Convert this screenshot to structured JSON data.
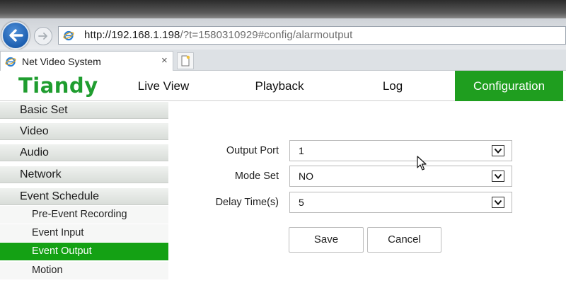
{
  "browser": {
    "url_host": "http://192.168.1.198",
    "url_rest": "/?t=1580310929#config/alarmoutput",
    "tab_title": "Net Video System",
    "tab_close": "×"
  },
  "app": {
    "logo": "Tiandy",
    "nav": [
      {
        "label": "Live View"
      },
      {
        "label": "Playback"
      },
      {
        "label": "Log"
      },
      {
        "label": "Configuration",
        "active": true
      }
    ]
  },
  "sidebar": {
    "categories": [
      "Basic Set",
      "Video",
      "Audio",
      "Network",
      "Event Schedule"
    ],
    "sub_items": [
      {
        "label": "Pre-Event Recording"
      },
      {
        "label": "Event Input"
      },
      {
        "label": "Event Output",
        "active": true
      },
      {
        "label": "Motion"
      }
    ]
  },
  "form": {
    "output_port": {
      "label": "Output Port",
      "value": "1"
    },
    "mode_set": {
      "label": "Mode Set",
      "value": "NO"
    },
    "delay_time": {
      "label": "Delay Time(s)",
      "value": "5"
    },
    "save_label": "Save",
    "cancel_label": "Cancel"
  },
  "colors": {
    "accent_green": "#1f9e1f",
    "logo_green": "#1f9d2f",
    "back_button_blue": "#1d5fb0"
  },
  "icons": {
    "back": "back-arrow-icon",
    "forward": "forward-arrow-icon",
    "browser": "ie-logo-icon",
    "new_tab": "new-tab-icon",
    "dropdown": "chevron-down-icon",
    "cursor": "mouse-cursor-icon"
  }
}
